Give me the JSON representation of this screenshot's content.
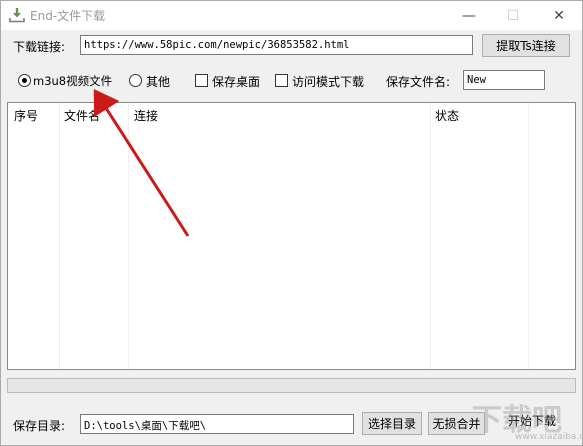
{
  "window": {
    "title": "End-文件下载",
    "min_symbol": "—",
    "max_symbol": "☐",
    "close_symbol": "✕"
  },
  "url_row": {
    "label": "下载链接:",
    "value": "https://www.58pic.com/newpic/36853582.html",
    "fetch_button": "提取Ts连接"
  },
  "options": {
    "radio_m3u8": "m3u8视频文件",
    "radio_m3u8_selected": true,
    "radio_other": "其他",
    "check_save_desktop": "保存桌面",
    "check_access_mode": "访问模式下载",
    "filename_label": "保存文件名:",
    "filename_value": "New"
  },
  "table": {
    "columns": [
      "序号",
      "文件名",
      "连接",
      "状态"
    ],
    "rows": []
  },
  "progress": {
    "value": 0
  },
  "bottom": {
    "dir_label": "保存目录:",
    "dir_value": "D:\\tools\\桌面\\下载吧\\",
    "choose_dir_button": "选择目录",
    "lossless_merge_button": "无损合并",
    "start_download_button": "开始下载"
  },
  "colors": {
    "arrow": "#cc1a1a",
    "title_text": "#999999"
  },
  "icons": {
    "app": "download-app-icon",
    "watermark": "site-logo-watermark"
  },
  "watermark_text": "www.xiazaiba.com"
}
